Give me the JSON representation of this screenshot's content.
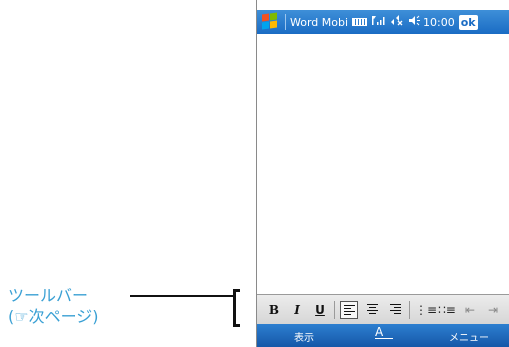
{
  "annotation": {
    "label": "ツールバー",
    "note": "(☞次ページ)"
  },
  "titlebar": {
    "app_title": "Word Mobil",
    "time": "10:00",
    "ok_label": "ok"
  },
  "toolbar": {
    "bold": "B",
    "italic": "I",
    "underline": "U",
    "list_numbered": "⋮≡",
    "list_bulleted": "∷≡",
    "indent_decrease": "⇤",
    "indent_increase": "⇥"
  },
  "softkeys": {
    "left": "表示",
    "center": "A",
    "right": "メニュー"
  },
  "colors": {
    "accent": "#1a6cc4",
    "annotation_text": "#3aa0d4"
  }
}
